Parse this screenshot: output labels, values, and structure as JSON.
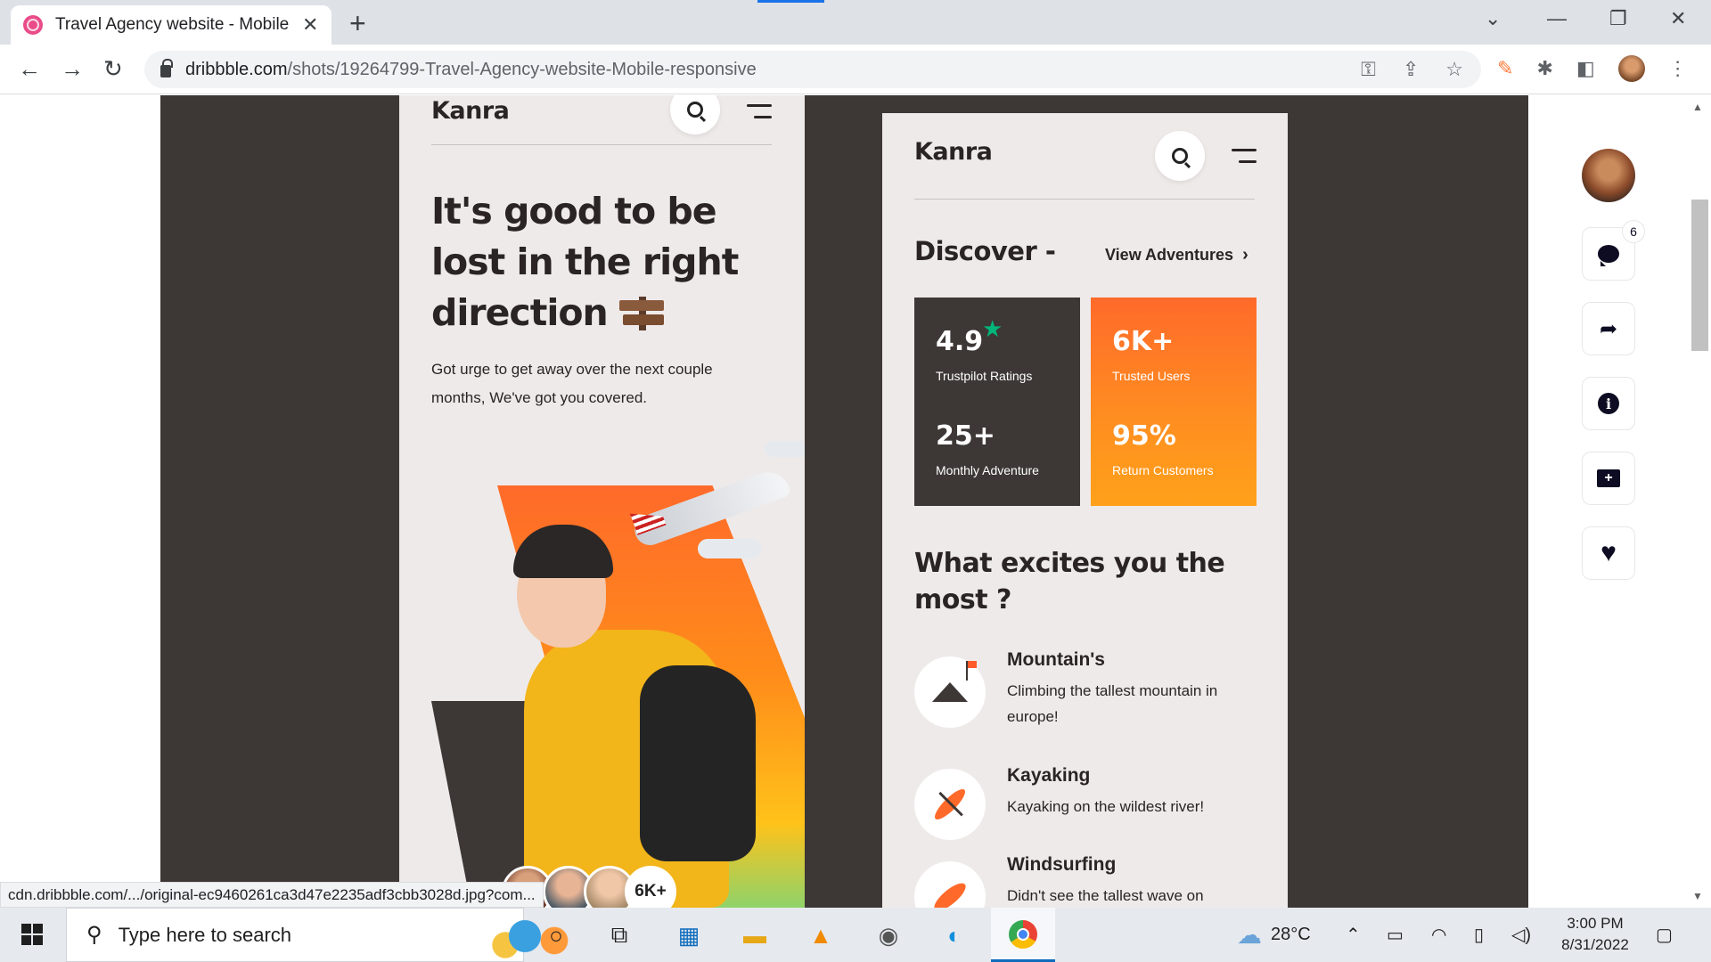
{
  "browser": {
    "tab_title": "Travel Agency website - Mobile responsive",
    "new_tab": "+",
    "url_domain": "dribbble.com",
    "url_path": "/shots/19264799-Travel-Agency-website-Mobile-responsive"
  },
  "phone1": {
    "logo": "Kanra",
    "hero_title": "It's good to be lost in the right direction",
    "hero_sub": "Got urge to get away over the next couple months, We've got you covered.",
    "users_badge": "6K+"
  },
  "phone2": {
    "logo": "Kanra",
    "discover": "Discover -",
    "view_adventures": "View Adventures",
    "stats": {
      "rating_value": "4.9",
      "rating_label": "Trustpilot Ratings",
      "users_value": "6K+",
      "users_label": "Trusted Users",
      "monthly_value": "25+",
      "monthly_label": "Monthly Adventure",
      "return_value": "95%",
      "return_label": "Return Customers"
    },
    "excite_title": "What excites you the most ?",
    "activities": [
      {
        "title": "Mountain's",
        "desc": "Climbing the tallest mountain in europe!"
      },
      {
        "title": "Kayaking",
        "desc": "Kayaking on the wildest river!"
      },
      {
        "title": "Windsurfing",
        "desc": "Didn't see the tallest wave on"
      }
    ]
  },
  "rail": {
    "comment_count": "6"
  },
  "status_url": "cdn.dribbble.com/.../original-ec9460261ca3d47e2235adf3cbb3028d.jpg?com...",
  "taskbar": {
    "search_placeholder": "Type here to search",
    "temperature": "28°C",
    "time": "3:00 PM",
    "date": "8/31/2022"
  }
}
